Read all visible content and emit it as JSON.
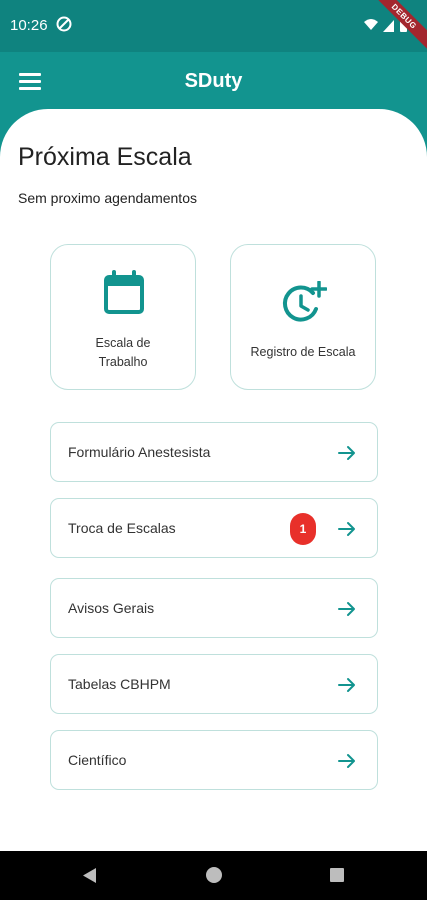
{
  "status_bar": {
    "time": "10:26",
    "debug_label": "DEBUG"
  },
  "app_bar": {
    "title": "SDuty",
    "menu_icon": "hamburger-menu-icon"
  },
  "main": {
    "title": "Próxima Escala",
    "subtitle": "Sem proximo agendamentos",
    "tiles": [
      {
        "label": "Escala de Trabalho",
        "icon": "calendar-icon"
      },
      {
        "label": "Registro de Escala",
        "icon": "clock-plus-icon"
      }
    ],
    "list_items": [
      {
        "label": "Formulário Anestesista"
      },
      {
        "label": "Troca de Escalas",
        "badge": "1"
      },
      {
        "label": "Avisos Gerais"
      },
      {
        "label": "Tabelas CBHPM"
      },
      {
        "label": "Científico"
      }
    ]
  },
  "colors": {
    "primary": "#12948f",
    "status_bar": "#0f837f",
    "badge": "#e8302a",
    "border": "#bfe0dc"
  }
}
